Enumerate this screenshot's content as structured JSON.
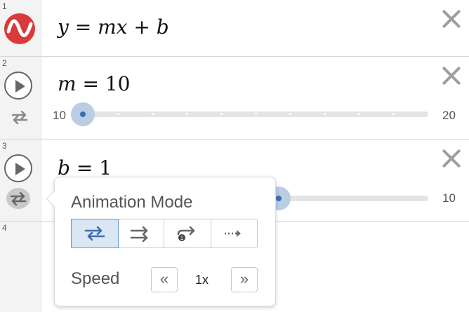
{
  "rows": [
    {
      "number": "1",
      "math": {
        "lhs": "y",
        "eq": " = ",
        "rhs": "mx + b"
      }
    },
    {
      "number": "2",
      "math": {
        "lhs": "m",
        "eq": " = ",
        "rhs": "10"
      },
      "slider": {
        "min": "10",
        "max": "20",
        "value": 10
      }
    },
    {
      "number": "3",
      "math": {
        "lhs": "b",
        "eq": " = ",
        "rhs": "1"
      },
      "slider": {
        "min": "",
        "max": "10",
        "value": 1
      }
    },
    {
      "number": "4"
    }
  ],
  "popup": {
    "title": "Animation Mode",
    "modes": [
      "oscillating",
      "increasing",
      "increasing-once",
      "decreasing"
    ],
    "selected_mode": "oscillating",
    "speed_label": "Speed",
    "speed_value": "1x",
    "slower": "«",
    "faster": "»"
  },
  "colors": {
    "accent": "#3c6fb0",
    "logo": "#d93a3a"
  }
}
